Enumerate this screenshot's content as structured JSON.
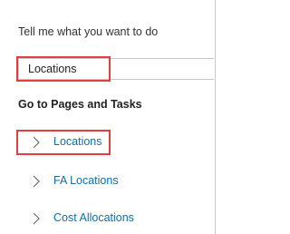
{
  "header": {
    "title": "Tell me what you want to do"
  },
  "search": {
    "value": "Locations"
  },
  "results": {
    "section_heading": "Go to Pages and Tasks",
    "items": [
      {
        "label": "Locations",
        "icon": "chevron-right-icon"
      },
      {
        "label": "FA Locations",
        "icon": "chevron-right-icon"
      },
      {
        "label": "Cost Allocations",
        "icon": "chevron-right-icon"
      }
    ]
  },
  "colors": {
    "highlight": "#e23e3e",
    "link": "#0f6fa8"
  }
}
